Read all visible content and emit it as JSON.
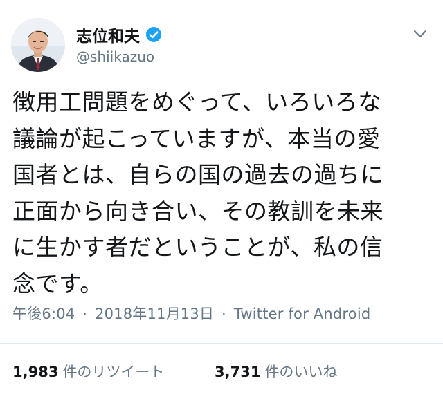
{
  "user": {
    "display_name": "志位和夫",
    "handle": "@shiikazuo",
    "verified": true
  },
  "tweet": {
    "lines": [
      "徴用工問題をめぐって、いろいろな",
      "議論が起こっていますが、本当の愛",
      "国者とは、自らの国の過去の過ちに",
      "正面から向き合い、その教訓を未来",
      "に生かす者だということが、私の信",
      "念です。"
    ]
  },
  "meta": {
    "time": "午後6:04",
    "separator": "·",
    "date": "2018年11月13日",
    "source": "Twitter for Android"
  },
  "stats": {
    "retweets_count": "1,983",
    "retweets_label": "件のリツイート",
    "likes_count": "3,731",
    "likes_label": "件のいいね"
  },
  "colors": {
    "text": "#14171a",
    "secondary": "#657786",
    "verified_badge": "#1da1f2",
    "divider": "#e1e8ed"
  },
  "icons": {
    "verified": "verified-badge-icon",
    "menu": "chevron-down-icon"
  }
}
